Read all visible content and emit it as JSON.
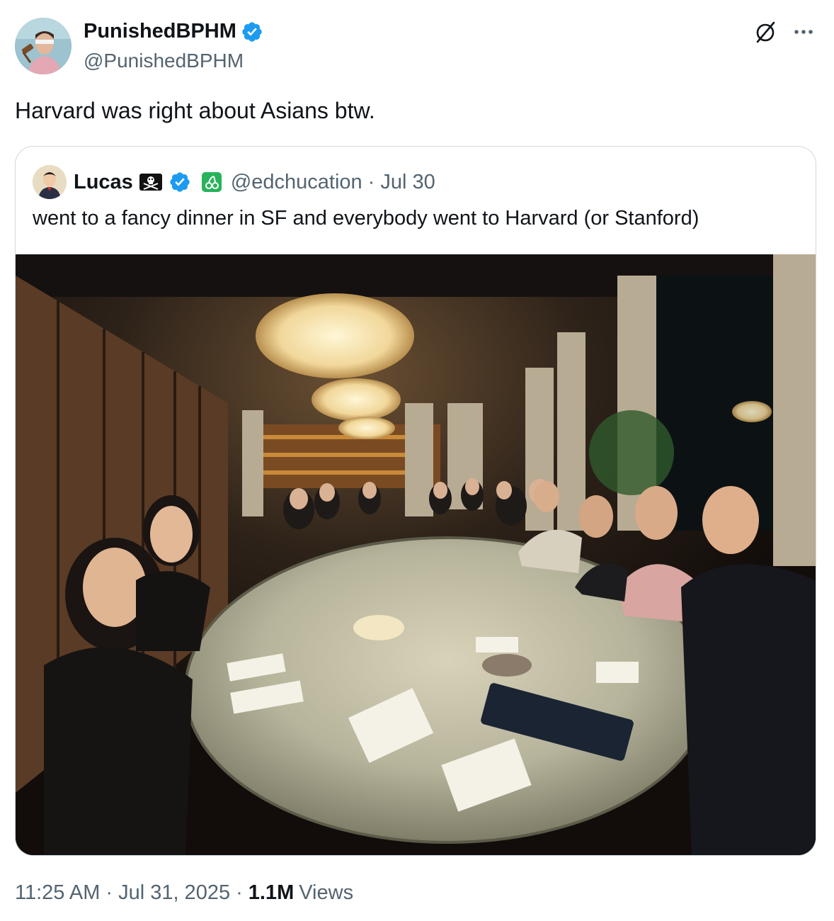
{
  "author": {
    "name": "PunishedBPHM",
    "handle": "@PunishedBPHM",
    "verified": true
  },
  "tweet": {
    "text": "Harvard was right about Asians btw."
  },
  "quoted": {
    "name": "Lucas",
    "handle": "@edchucation",
    "separator": "·",
    "date": "Jul 30",
    "text": "went to a fancy dinner in SF and everybody went to Harvard (or Stanford)",
    "badges": [
      "pirate-flag-icon",
      "verified-icon",
      "green-cherry-icon"
    ]
  },
  "meta": {
    "time": "11:25 AM",
    "sep1": "·",
    "date": "Jul 31, 2025",
    "sep2": "·",
    "views_count": "1.1M",
    "views_label": "Views"
  },
  "icons": {
    "grok": "grok-icon",
    "more": "more-options-icon"
  },
  "colors": {
    "verified": "#1d9bf0",
    "text": "#0f1419",
    "secondary": "#536471",
    "border": "#cfd9de"
  }
}
